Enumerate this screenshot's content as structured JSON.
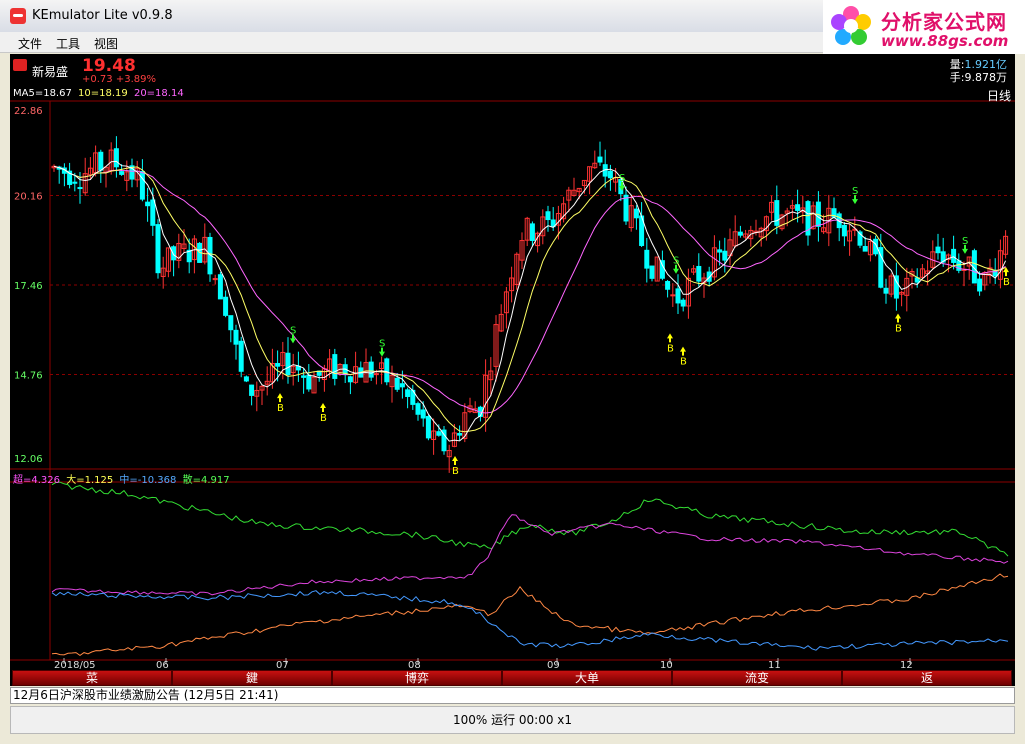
{
  "window": {
    "title": "KEmulator Lite v0.9.8"
  },
  "logo": {
    "title": "分析家公式网",
    "url": "www.88gs.com"
  },
  "menu": [
    "文件",
    "工具",
    "视图"
  ],
  "stock": {
    "name": "新易盛",
    "price": "19.48",
    "change": "+0.73",
    "change_pct": "+3.89%"
  },
  "volume": {
    "label": "量:",
    "value": "1.921亿"
  },
  "hands": {
    "label": "手:",
    "value": "9.878万"
  },
  "ma_line": [
    {
      "text": "MA5=18.67",
      "color": "#ffffff"
    },
    {
      "text": "10=18.19",
      "color": "#ffff66"
    },
    {
      "text": "20=18.14",
      "color": "#ff66ff"
    }
  ],
  "period": "日线",
  "indicator_line": [
    {
      "text": "超=4.326",
      "color": "#ff55ff"
    },
    {
      "text": "大=1.125",
      "color": "#ffff55"
    },
    {
      "text": "中=-10.368",
      "color": "#55aaff"
    },
    {
      "text": "散=4.917",
      "color": "#55ff55"
    }
  ],
  "colors": {
    "up": "#ff3333",
    "down": "#00ffff",
    "grid": "#8b0000",
    "ma5": "#ffffff",
    "ma10": "#ffff66",
    "ma20": "#ff66ff",
    "ind_super": "#dd44dd",
    "ind_big": "#ff8844",
    "ind_mid": "#4499ff",
    "ind_retail": "#33dd33",
    "buy": "#ffff00",
    "sell": "#33ff33"
  },
  "chart_data": {
    "type": "candlestick",
    "y_ticks": [
      "22.86",
      "20.16",
      "17.46",
      "14.76",
      "12.06"
    ],
    "ylim": [
      12.06,
      22.86
    ],
    "x_ticks": [
      "2018/05",
      "06",
      "07",
      "08",
      "09",
      "10",
      "11",
      "12"
    ],
    "signals": {
      "buy": "B",
      "sell": "S"
    },
    "ma": {
      "ma5": 18.67,
      "ma10": 18.19,
      "ma20": 18.14
    },
    "indicator": {
      "超": 4.326,
      "大": 1.125,
      "中": -10.368,
      "散": 4.917
    }
  },
  "tabs": [
    "菜",
    "鍵",
    "博弈",
    "大单",
    "流变",
    "返"
  ],
  "news": {
    "text": "12月6日沪深股市业绩激励公告 (12月5日 21:41)"
  },
  "status": {
    "text": "100% 运行 00:00 x1"
  }
}
